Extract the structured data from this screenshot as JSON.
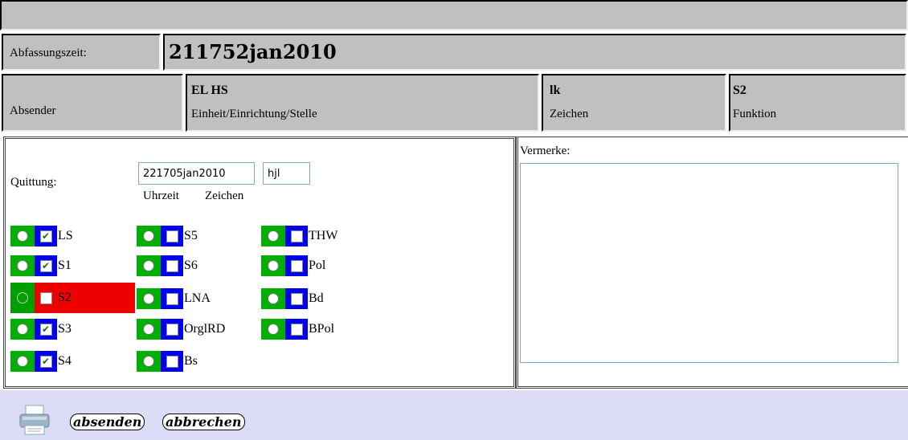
{
  "header": {
    "abfassungszeit_label": "Abfassungszeit:",
    "abfassungszeit_value": "211752jan2010"
  },
  "sender": {
    "label": "Absender",
    "unit_value": "EL HS",
    "unit_caption": "Einheit/Einrichtung/Stelle",
    "sign_value": "lk",
    "sign_caption": "Zeichen",
    "function_value": "S2",
    "function_caption": "Funktion"
  },
  "receipt": {
    "label": "Quittung:",
    "time_value": "221705jan2010",
    "sign_value": "hjl",
    "time_caption": "Uhrzeit",
    "sign_caption": "Zeichen"
  },
  "recipients": {
    "col1": [
      {
        "name": "LS",
        "checked": true,
        "alarm": false
      },
      {
        "name": "S1",
        "checked": true,
        "alarm": false
      },
      {
        "name": "S2",
        "checked": false,
        "alarm": true
      },
      {
        "name": "S3",
        "checked": true,
        "alarm": false
      },
      {
        "name": "S4",
        "checked": true,
        "alarm": false
      }
    ],
    "col2": [
      {
        "name": "S5",
        "checked": false
      },
      {
        "name": "S6",
        "checked": false
      },
      {
        "name": "LNA",
        "checked": false
      },
      {
        "name": "OrglRD",
        "checked": false
      },
      {
        "name": "Bs",
        "checked": false
      }
    ],
    "col3": [
      {
        "name": "THW",
        "checked": false
      },
      {
        "name": "Pol",
        "checked": false
      },
      {
        "name": "Bd",
        "checked": false
      },
      {
        "name": "BPol",
        "checked": false
      }
    ]
  },
  "notes": {
    "label": "Vermerke:",
    "value": ""
  },
  "footer": {
    "send_label": "absenden",
    "cancel_label": "abbrechen",
    "print_icon": "printer-icon"
  },
  "colors": {
    "radio_bg": "#00b000",
    "checkbox_bg": "#0000ee",
    "alarm_bg": "#ee0000",
    "footer_bg": "#dcdcf8",
    "cell_bg": "#c0c0c0"
  }
}
